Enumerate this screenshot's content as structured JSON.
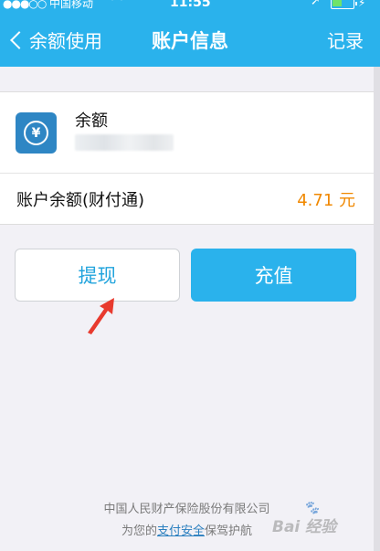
{
  "status_bar": {
    "signal": "●●●○○",
    "carrier": "中国移动",
    "time": "11:55",
    "location_glyph": "➚",
    "charge_glyph": "⚡"
  },
  "nav": {
    "back_label": "余额使用",
    "title": "账户信息",
    "record_label": "记录"
  },
  "balance": {
    "title": "余额",
    "icon_glyph": "¥",
    "icon": "yuan-coin-icon",
    "icon_color": "#2e86c4"
  },
  "account": {
    "label": "账户余额(财付通)",
    "amount": "4.71 元",
    "amount_color": "#f08800"
  },
  "buttons": {
    "withdraw": "提现",
    "recharge": "充值"
  },
  "footer": {
    "company": "中国人民财产保险股份有限公司",
    "line2_prefix": "为您的",
    "line2_link": "支付安全",
    "line2_suffix": "保驾护航"
  },
  "watermark": {
    "text": "Bai 经验"
  },
  "colors": {
    "accent": "#2ab2ec",
    "background": "#f2f1f6",
    "annotation_arrow": "#e83a2e"
  }
}
